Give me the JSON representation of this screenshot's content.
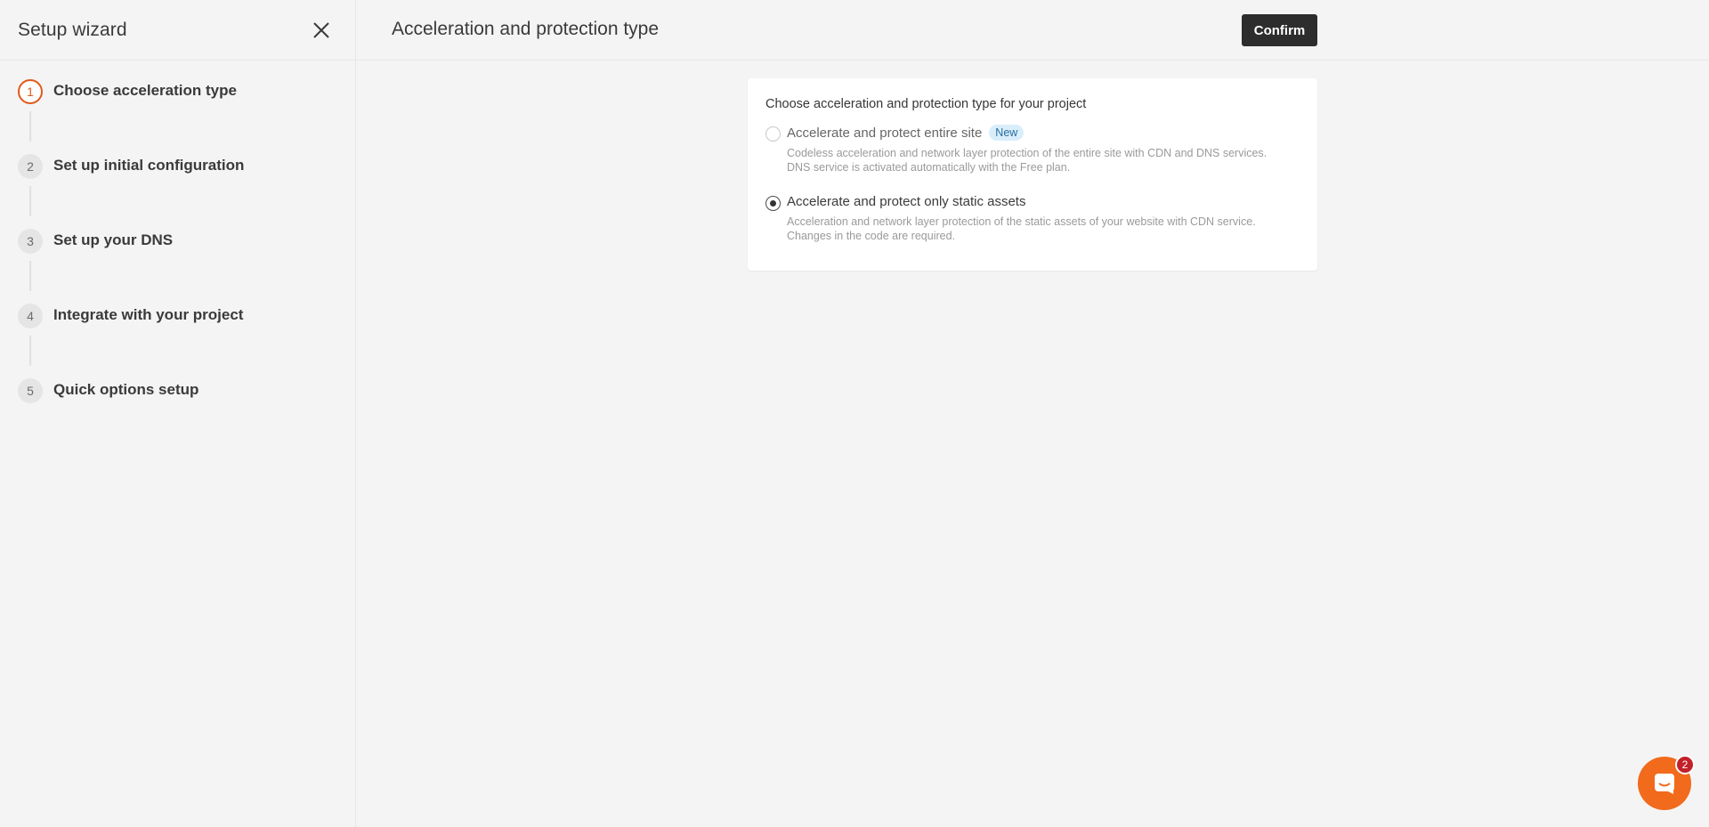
{
  "sidebar": {
    "title": "Setup wizard",
    "close_icon": "close-icon",
    "steps": [
      {
        "num": "1",
        "label": "Choose acceleration type",
        "active": true
      },
      {
        "num": "2",
        "label": "Set up initial configuration",
        "active": false
      },
      {
        "num": "3",
        "label": "Set up your DNS",
        "active": false
      },
      {
        "num": "4",
        "label": "Integrate with your project",
        "active": false
      },
      {
        "num": "5",
        "label": "Quick options setup",
        "active": false
      }
    ]
  },
  "header": {
    "title": "Acceleration and protection type",
    "confirm_label": "Confirm"
  },
  "card": {
    "heading": "Choose acceleration and protection type for your project",
    "options": [
      {
        "title": "Accelerate and protect entire site",
        "badge": "New",
        "desc_line1": "Codeless acceleration and network layer protection of the entire site with CDN and DNS services.",
        "desc_line2": "DNS service is activated automatically with the Free plan.",
        "selected": false
      },
      {
        "title": "Accelerate and protect only static assets",
        "desc_line1": "Acceleration and network layer protection of the static assets of your website with CDN service.",
        "desc_line2": "Changes in the code are required.",
        "selected": true
      }
    ]
  },
  "chat": {
    "icon": "chat-icon",
    "unread": "2"
  },
  "colors": {
    "accent": "#e05a1b",
    "chat": "#f26a1b",
    "badge_bg": "#d9eefb",
    "confirm_bg": "#2d2d2d"
  }
}
